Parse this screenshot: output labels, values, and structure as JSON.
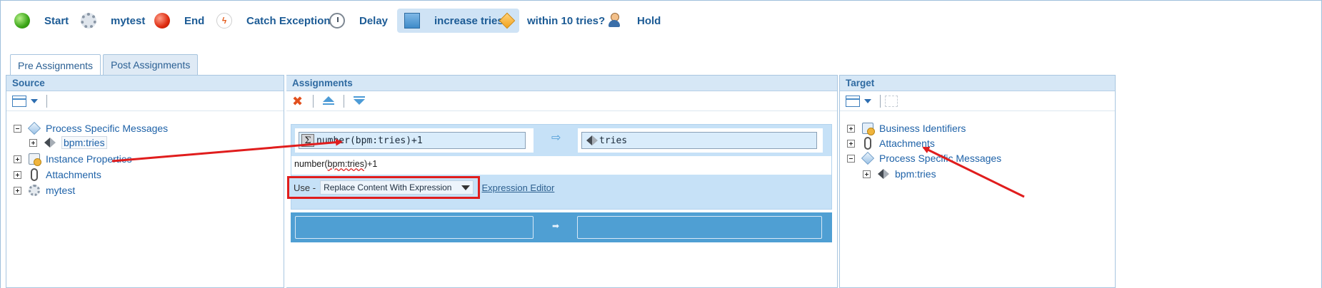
{
  "flow": {
    "items": [
      {
        "label": "Start",
        "icon": "start-event-icon"
      },
      {
        "label": "mytest",
        "icon": "gear-service-icon"
      },
      {
        "label": "End",
        "icon": "end-event-icon"
      },
      {
        "label": "Catch Exception",
        "icon": "catch-exception-icon"
      },
      {
        "label": "Delay",
        "icon": "timer-icon"
      },
      {
        "label": "increase tries",
        "icon": "task-icon",
        "active": true
      },
      {
        "label": "within 10 tries?",
        "icon": "gateway-diamond-icon"
      },
      {
        "label": "Hold",
        "icon": "human-task-icon"
      }
    ]
  },
  "tabs": {
    "pre": "Pre Assignments",
    "post": "Post Assignments"
  },
  "source": {
    "title": "Source",
    "tree": {
      "psm": "Process Specific Messages",
      "bpm_tries": "bpm:tries",
      "instance_props": "Instance Properties",
      "attachments": "Attachments",
      "mytest": "mytest"
    }
  },
  "assignments": {
    "title": "Assignments",
    "expression": "number(bpm:tries)+1",
    "target": "tries",
    "expression_text_a": "number(",
    "expression_text_b": "bpm:tries",
    "expression_text_c": ")+1",
    "use_label": "Use -",
    "use_selected": "Replace Content With Expression",
    "expression_editor": "Expression Editor"
  },
  "target": {
    "title": "Target",
    "tree": {
      "business_ids": "Business Identifiers",
      "attachments": "Attachments",
      "psm": "Process Specific Messages",
      "bpm_tries": "bpm:tries"
    }
  },
  "colors": {
    "annotation": "#e01d1d",
    "link": "#1e62a8",
    "header_bg": "#d6e7f6"
  }
}
